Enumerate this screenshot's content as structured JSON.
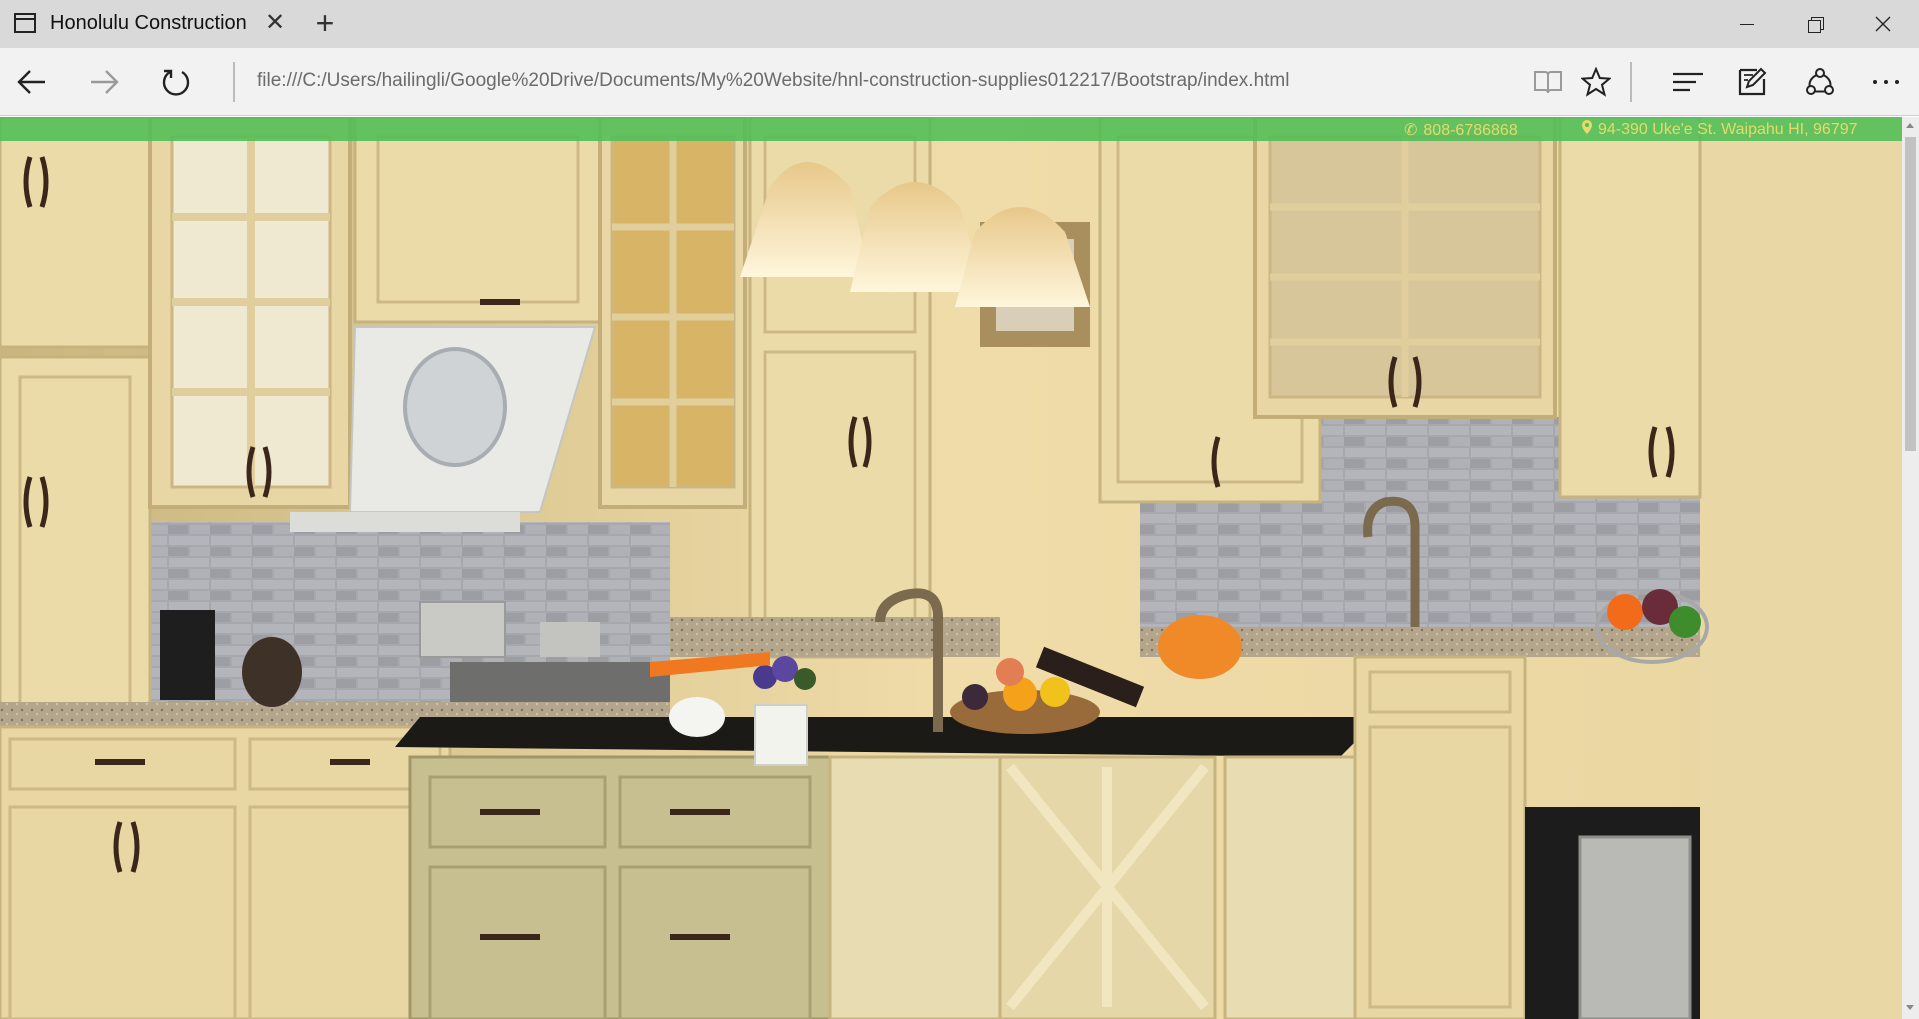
{
  "browser": {
    "tab": {
      "title": "Honolulu Construction",
      "close_glyph": "✕",
      "icon": "page-icon"
    },
    "new_tab_glyph": "+",
    "window_controls": [
      "minimize",
      "restore",
      "close"
    ],
    "address": "file:///C:/Users/hailingli/Google%20Drive/Documents/My%20Website/hnl-construction-supplies012217/Bootstrap/index.html",
    "nav_icons": [
      "back-arrow-icon",
      "forward-arrow-icon",
      "refresh-icon"
    ],
    "toolbar_icons": [
      "reading-view-icon",
      "favorite-star-icon",
      "hub-icon",
      "web-note-icon",
      "share-icon",
      "more-icon"
    ]
  },
  "page": {
    "contact": {
      "phone": "808-6786868",
      "address": "94-390 Uke'e St. Waipahu HI, 96797",
      "text_color": "#e9d96b",
      "bar_color": "#50be55"
    },
    "hero": {
      "subject": "kitchen with cream cabinets, dark granite island and pendant lights"
    }
  }
}
